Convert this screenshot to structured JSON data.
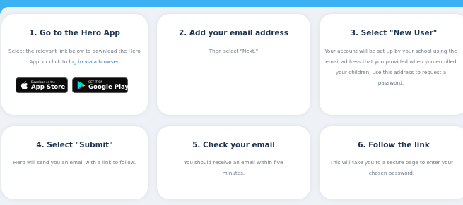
{
  "steps": [
    {
      "title": "1. Go to the Hero App",
      "text_before": "Select the relevant link below to download the Hero App, or click to ",
      "link": "log in via a browser",
      "text_after": "."
    },
    {
      "title": "2. Add your email address",
      "text": "Then select \"Next.\""
    },
    {
      "title": "3. Select \"New User\"",
      "text": "Your account will be set up by your school using the email address that you provided when you enrolled your children, use this address to request a password."
    },
    {
      "title": "4. Select \"Submit\"",
      "text": "Hero will send you an email with a link to follow."
    },
    {
      "title": "5. Check your email",
      "text": "You should receive an email within five minutes."
    },
    {
      "title": "6. Follow the link",
      "text": "This will take you to a secure page to enter your chosen password."
    }
  ],
  "badges": {
    "app_store": {
      "small": "Download on the",
      "big": "App Store",
      "icon": "apple-icon"
    },
    "google_play": {
      "small": "GET IT ON",
      "big": "Google Play",
      "icon": "google-play-icon"
    }
  },
  "colors": {
    "background": "#3bb1f3",
    "panel": "#eef1f6",
    "card": "#ffffff",
    "heading": "#1c3450",
    "body_text": "#6e7786",
    "link": "#2a7fc8"
  }
}
